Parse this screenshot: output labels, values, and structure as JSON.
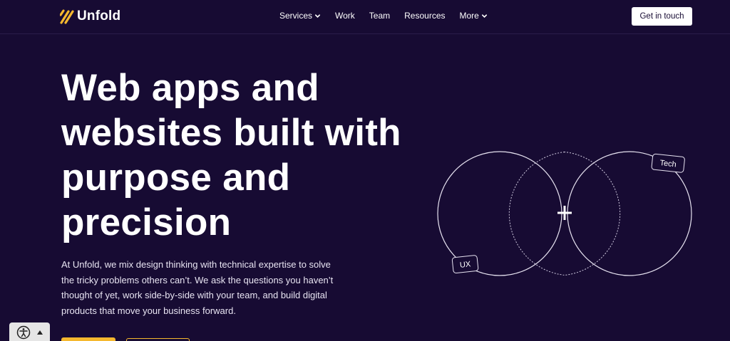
{
  "brand": {
    "name": "Unfold",
    "accent": "#f5b82e",
    "background": "#170b33"
  },
  "nav": {
    "items": [
      {
        "label": "Services",
        "dropdown": true
      },
      {
        "label": "Work",
        "dropdown": false
      },
      {
        "label": "Team",
        "dropdown": false
      },
      {
        "label": "Resources",
        "dropdown": false
      },
      {
        "label": "More",
        "dropdown": true
      }
    ],
    "cta_label": "Get in touch"
  },
  "hero": {
    "title_lines": [
      "Web apps and",
      "websites built with",
      "purpose and",
      "precision"
    ],
    "body": "At Unfold, we mix design thinking with technical expertise to solve the tricky problems others can’t. We ask the questions you haven’t thought of yet, work side-by-side with your team, and build digital products that move your business forward."
  },
  "diagram": {
    "left_label": "UX",
    "right_label": "Tech",
    "center_symbol": "+"
  },
  "accessibility": {
    "icon": "accessibility-icon",
    "toggle_icon": "caret-up-icon"
  }
}
